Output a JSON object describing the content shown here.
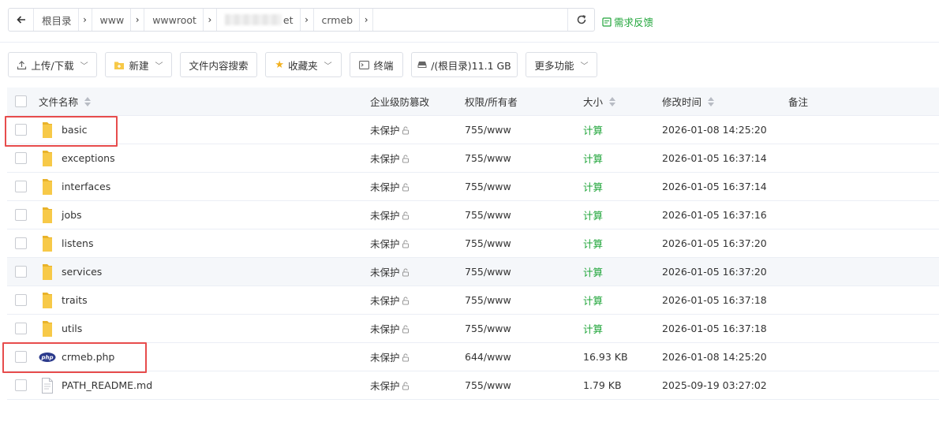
{
  "breadcrumb": {
    "items": [
      "根目录",
      "www",
      "wwwroot",
      "et",
      "crmeb"
    ]
  },
  "feedback_label": "需求反馈",
  "toolbar": {
    "upload_label": "上传/下载",
    "new_label": "新建",
    "search_content_label": "文件内容搜索",
    "favorites_label": "收藏夹",
    "terminal_label": "终端",
    "disk_label": "/(根目录)11.1 GB",
    "more_label": "更多功能"
  },
  "table": {
    "headers": {
      "name": "文件名称",
      "protect": "企业级防篡改",
      "perm": "权限/所有者",
      "size": "大小",
      "mtime": "修改时间",
      "note": "备注"
    },
    "rows": [
      {
        "name": "basic",
        "type": "folder",
        "protect": "未保护",
        "perm": "755/www",
        "size": "计算",
        "mtime": "2026-01-08 14:25:20"
      },
      {
        "name": "exceptions",
        "type": "folder",
        "protect": "未保护",
        "perm": "755/www",
        "size": "计算",
        "mtime": "2026-01-05 16:37:14"
      },
      {
        "name": "interfaces",
        "type": "folder",
        "protect": "未保护",
        "perm": "755/www",
        "size": "计算",
        "mtime": "2026-01-05 16:37:14"
      },
      {
        "name": "jobs",
        "type": "folder",
        "protect": "未保护",
        "perm": "755/www",
        "size": "计算",
        "mtime": "2026-01-05 16:37:16"
      },
      {
        "name": "listens",
        "type": "folder",
        "protect": "未保护",
        "perm": "755/www",
        "size": "计算",
        "mtime": "2026-01-05 16:37:20"
      },
      {
        "name": "services",
        "type": "folder",
        "protect": "未保护",
        "perm": "755/www",
        "size": "计算",
        "mtime": "2026-01-05 16:37:20"
      },
      {
        "name": "traits",
        "type": "folder",
        "protect": "未保护",
        "perm": "755/www",
        "size": "计算",
        "mtime": "2026-01-05 16:37:18"
      },
      {
        "name": "utils",
        "type": "folder",
        "protect": "未保护",
        "perm": "755/www",
        "size": "计算",
        "mtime": "2026-01-05 16:37:18"
      },
      {
        "name": "crmeb.php",
        "type": "php",
        "icon_text": "php",
        "protect": "未保护",
        "perm": "644/www",
        "size": "16.93 KB",
        "mtime": "2026-01-08 14:25:20"
      },
      {
        "name": "PATH_README.md",
        "type": "doc",
        "protect": "未保护",
        "perm": "755/www",
        "size": "1.79 KB",
        "mtime": "2025-09-19 03:27:02"
      }
    ]
  },
  "colors": {
    "accent": "#20a53a",
    "highlight": "#e74c4c",
    "folder": "#f7c948"
  }
}
